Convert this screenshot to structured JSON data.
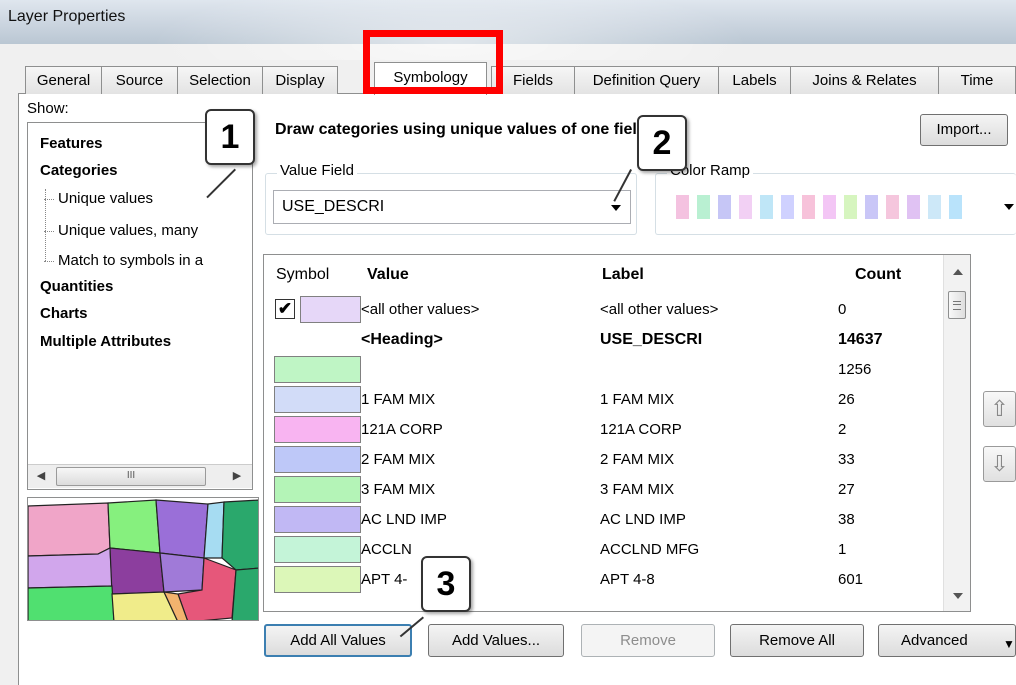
{
  "window": {
    "title": "Layer Properties"
  },
  "tabs": [
    {
      "label": "General"
    },
    {
      "label": "Source"
    },
    {
      "label": "Selection"
    },
    {
      "label": "Display"
    },
    {
      "label": "Symbology",
      "active": true
    },
    {
      "label": "Fields"
    },
    {
      "label": "Definition Query"
    },
    {
      "label": "Labels"
    },
    {
      "label": "Joins & Relates"
    },
    {
      "label": "Time"
    }
  ],
  "show": {
    "label": "Show:",
    "tree": {
      "features": "Features",
      "categories": "Categories",
      "unique_values": "Unique values",
      "unique_values_many": "Unique values, many",
      "match_symbols": "Match to symbols in a",
      "quantities": "Quantities",
      "charts": "Charts",
      "multiple_attributes": "Multiple Attributes"
    },
    "scroll_thumb_label": "III"
  },
  "description": "Draw categories using unique values of one field.",
  "import_button": "Import...",
  "value_field": {
    "label": "Value Field",
    "value": "USE_DESCRI"
  },
  "color_ramp": {
    "label": "Color Ramp",
    "colors": [
      "#f4c2e0",
      "#b9f0d2",
      "#c6c6f6",
      "#f2d0f4",
      "#bfe6f7",
      "#cfd1ff",
      "#f7c2da",
      "#f3c6f5",
      "#d6f5bf",
      "#c9c6f7",
      "#f5c6dd",
      "#e0c2f3",
      "#cde8f8",
      "#b9e3fb"
    ]
  },
  "grid": {
    "headers": {
      "symbol": "Symbol",
      "value": "Value",
      "label": "Label",
      "count": "Count"
    },
    "rows": [
      {
        "symbol_color": "#e6d7f8",
        "checkbox": true,
        "value": "<all other values>",
        "label": "<all other values>",
        "count": "0",
        "bold": false
      },
      {
        "symbol_color": "",
        "value": "<Heading>",
        "label": "USE_DESCRI",
        "count": "14637",
        "bold": true
      },
      {
        "symbol_color": "#bff5c5",
        "value": "",
        "label": "",
        "count": "1256",
        "bold": false
      },
      {
        "symbol_color": "#d2dcf8",
        "value": "1 FAM  MIX",
        "label": "1 FAM  MIX",
        "count": "26",
        "bold": false
      },
      {
        "symbol_color": "#f8b4f1",
        "value": "121A CORP",
        "label": "121A CORP",
        "count": "2",
        "bold": false
      },
      {
        "symbol_color": "#bec8f8",
        "value": "2 FAM  MIX",
        "label": "2 FAM  MIX",
        "count": "33",
        "bold": false
      },
      {
        "symbol_color": "#b4f4b7",
        "value": "3 FAM  MIX",
        "label": "3 FAM  MIX",
        "count": "27",
        "bold": false
      },
      {
        "symbol_color": "#c1b8f4",
        "value": "AC LND IMP",
        "label": "AC LND IMP",
        "count": "38",
        "bold": false
      },
      {
        "symbol_color": "#c4f4d8",
        "value": "ACCLN",
        "label": "ACCLND MFG",
        "count": "1",
        "bold": false
      },
      {
        "symbol_color": "#dcf7b8",
        "value": "APT 4-",
        "label": "APT 4-8",
        "count": "601",
        "bold": false
      }
    ]
  },
  "move_buttons": {
    "up": "⇧",
    "down": "⇩"
  },
  "buttons": {
    "add_all": "Add All Values",
    "add_values": "Add Values...",
    "remove": "Remove",
    "remove_all": "Remove All",
    "advanced": "Advanced"
  },
  "callouts": {
    "one": "1",
    "two": "2",
    "three": "3"
  },
  "highlight_color": "#ff0000"
}
